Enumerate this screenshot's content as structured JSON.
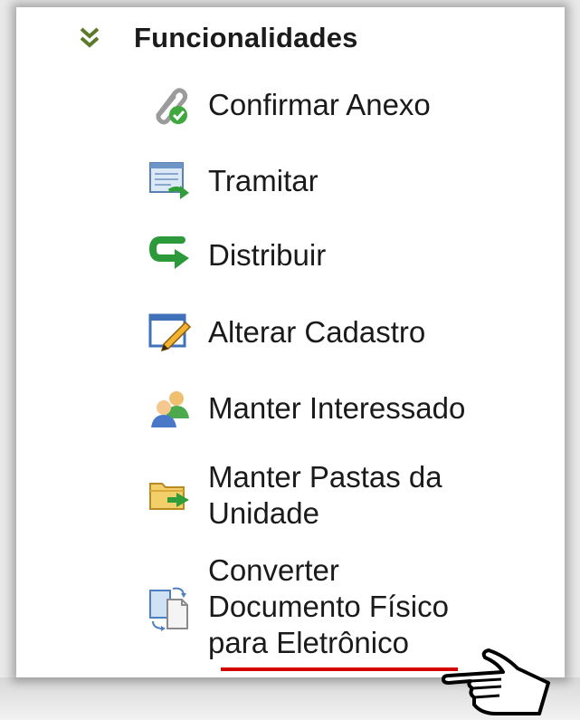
{
  "section": {
    "title": "Funcionalidades",
    "icon": "chevron-double-down-icon"
  },
  "menu": [
    {
      "label": "Confirmar Anexo",
      "icon": "attachment-check-icon"
    },
    {
      "label": "Tramitar",
      "icon": "forward-document-icon"
    },
    {
      "label": "Distribuir",
      "icon": "distribute-arrow-icon"
    },
    {
      "label": "Alterar Cadastro",
      "icon": "edit-pencil-icon"
    },
    {
      "label": "Manter Interessado",
      "icon": "users-icon"
    },
    {
      "label": "Manter Pastas da\nUnidade",
      "icon": "folder-arrow-icon"
    },
    {
      "label": "Converter\nDocumento Físico\npara Eletrônico",
      "icon": "convert-document-icon"
    }
  ],
  "colors": {
    "highlight_underline": "#d40000",
    "chevron": "#5a7a2a"
  }
}
